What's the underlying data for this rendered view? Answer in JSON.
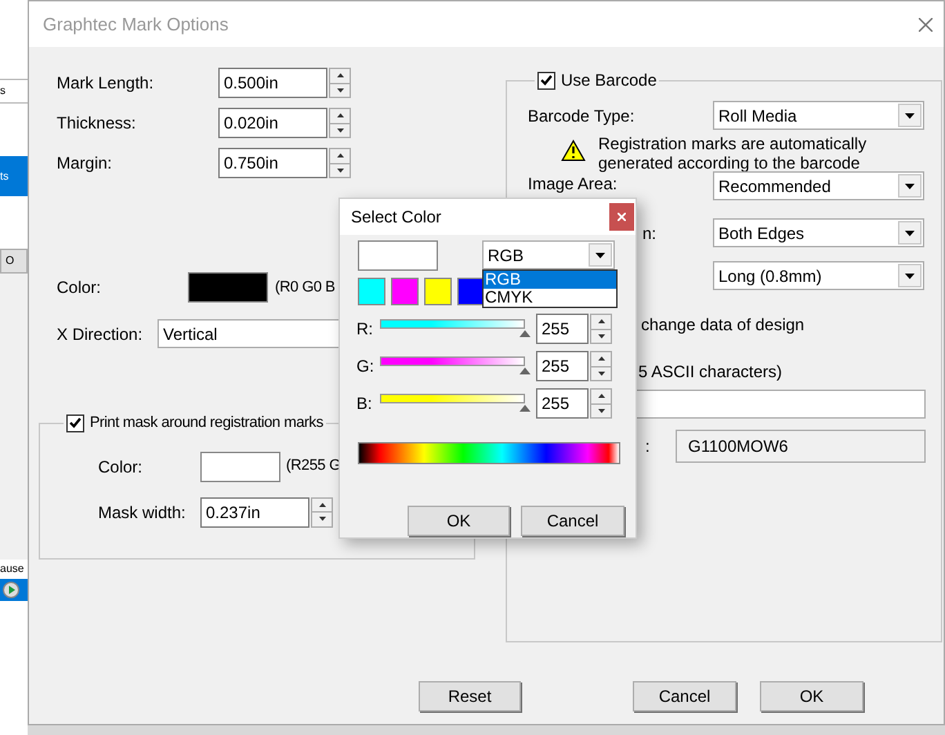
{
  "background_app": {
    "texts": [
      "s",
      "ts",
      "O",
      "ause"
    ]
  },
  "window": {
    "title": "Graphtec Mark Options"
  },
  "mark": {
    "fields": [
      {
        "label": "Mark Length:",
        "value": "0.500in"
      },
      {
        "label": "Thickness:",
        "value": "0.020in"
      },
      {
        "label": "Margin:",
        "value": "0.750in"
      }
    ],
    "color": {
      "label": "Color:",
      "color": "#000000",
      "reading": "(R0 G0 B"
    },
    "x_direction": {
      "label": "X Direction:",
      "value": "Vertical"
    }
  },
  "mask": {
    "checkbox": {
      "label": "Print mask around registration marks",
      "checked": true
    },
    "color": {
      "label": "Color:",
      "color": "#ffffff",
      "reading": "(R255 G"
    },
    "mask_width": {
      "label": "Mask width:",
      "value": "0.237in"
    }
  },
  "barcode": {
    "checkbox": {
      "label": "Use Barcode",
      "checked": true
    },
    "barcode_type": {
      "label": "Barcode Type:",
      "value": "Roll Media"
    },
    "warning": "Registration marks are automatically generated according to the barcode",
    "image_area": {
      "label": "Image Area:",
      "value": "Recommended"
    },
    "row_3": {
      "label": "n:",
      "value": "Both Edges"
    },
    "row_4": {
      "value": "Long (0.8mm)"
    },
    "option_text": "change data of design",
    "field_label": "5 ASCII characters)",
    "id_label": ":",
    "id_value": "G1100MOW6"
  },
  "buttons": [
    "Reset",
    "Cancel",
    "OK"
  ],
  "select_color": {
    "title": "Select Color",
    "mode": {
      "value": "RGB",
      "options": [
        {
          "label": "RGB",
          "selected": true
        },
        {
          "label": "CMYK",
          "selected": false
        }
      ]
    },
    "swatches": [
      {
        "color": "#00ffff"
      },
      {
        "color": "#ff00ff"
      },
      {
        "color": "#ffff00"
      },
      {
        "color": "#0000ff"
      }
    ],
    "sliders": [
      {
        "label": "R:",
        "color": "#00ffff",
        "level": 1,
        "value": "255"
      },
      {
        "label": "G:",
        "color": "#ff00ff",
        "level": 1,
        "value": "255"
      },
      {
        "label": "B:",
        "color": "#ffff00",
        "level": 1,
        "value": "255"
      }
    ],
    "buttons": [
      "OK",
      "Cancel"
    ]
  }
}
